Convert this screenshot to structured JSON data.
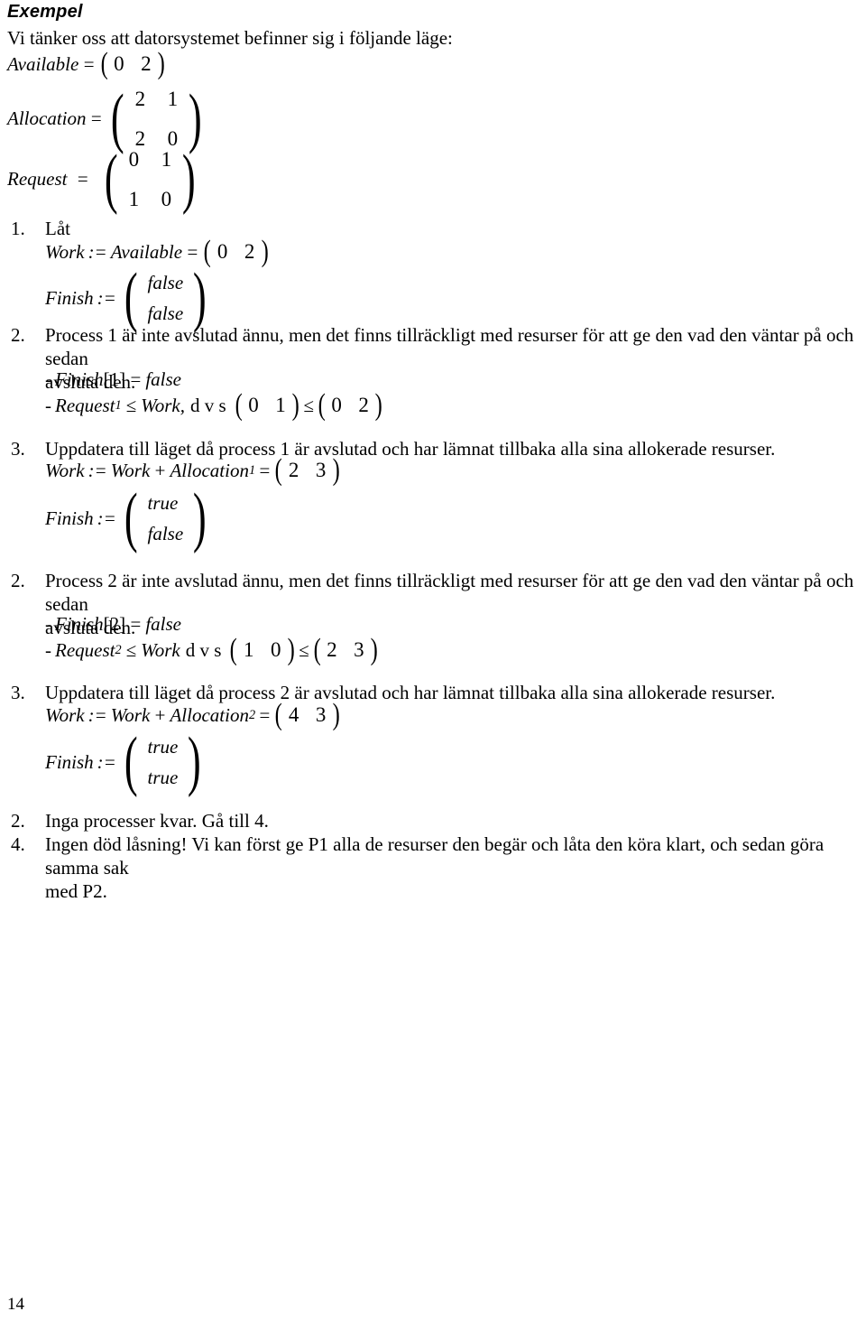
{
  "document": {
    "page_number": "14",
    "heading": "Exempel",
    "intro": "Vi tänker oss att datorsystemet befinner sig i följande läge:"
  },
  "state": {
    "available": {
      "label": "Available",
      "eq": "=",
      "values": [
        "0",
        "2"
      ]
    },
    "allocation": {
      "label": "Allocation",
      "eq": "=",
      "rows": [
        [
          "2",
          "1"
        ],
        [
          "2",
          "0"
        ]
      ]
    },
    "request": {
      "label": "Request",
      "eq": "=",
      "rows": [
        [
          "0",
          "1"
        ],
        [
          "1",
          "0"
        ]
      ]
    }
  },
  "steps": [
    {
      "num": "1.",
      "title": "Låt",
      "work_line": {
        "lhs": "Work",
        "assign": ":=",
        "rhs": "Available",
        "eq": "=",
        "values": [
          "0",
          "2"
        ]
      },
      "finish_line": {
        "label": "Finish",
        "assign": ":=",
        "values": [
          "false",
          "false"
        ]
      }
    },
    {
      "num": "2.",
      "text_line1": "Process 1 är inte avslutad ännu, men det finns tillräckligt med resurser för att ge den vad den väntar på och sedan",
      "text_line2": "avsluta den.",
      "bullet1": {
        "dash": "-",
        "name": "Finish",
        "index": "[1]",
        "eq": "=",
        "value": "false"
      },
      "bullet2": {
        "dash": "-",
        "name": "Request",
        "sub": "1",
        "rel": "≤",
        "work": "Work,",
        "note": "d v s",
        "left": [
          "0",
          "1"
        ],
        "rel2": "≤",
        "right": [
          "0",
          "2"
        ]
      }
    },
    {
      "num": "3.",
      "title": "Uppdatera till läget då process 1 är avslutad och har lämnat tillbaka alla sina allokerade resurser.",
      "work_line": {
        "lhs": "Work",
        "assign": ":=",
        "rhs": "Work",
        "plus": "+",
        "alloc": "Allocation",
        "sub": "1",
        "eq": "=",
        "values": [
          "2",
          "3"
        ]
      },
      "finish_line": {
        "label": "Finish",
        "assign": ":=",
        "values": [
          "true",
          "false"
        ]
      }
    },
    {
      "num": "2.",
      "text_line1": "Process 2 är inte avslutad ännu, men det finns tillräckligt med resurser för att ge den vad den väntar på och sedan",
      "text_line2": "avsluta den.",
      "bullet1": {
        "dash": "-",
        "name": "Finish",
        "index": "[2]",
        "eq": "=",
        "value": "false"
      },
      "bullet2": {
        "dash": "-",
        "name": "Request",
        "sub": "2",
        "rel": "≤",
        "work": "Work",
        "note": "d v s",
        "left": [
          "1",
          "0"
        ],
        "rel2": "≤",
        "right": [
          "2",
          "3"
        ]
      }
    },
    {
      "num": "3.",
      "title": "Uppdatera till läget då process 2 är avslutad och har lämnat tillbaka alla sina allokerade resurser.",
      "work_line": {
        "lhs": "Work",
        "assign": ":=",
        "rhs": "Work",
        "plus": "+",
        "alloc": "Allocation",
        "sub": "2",
        "eq": "=",
        "values": [
          "4",
          "3"
        ]
      },
      "finish_line": {
        "label": "Finish",
        "assign": ":=",
        "values": [
          "true",
          "true"
        ]
      }
    },
    {
      "num": "2.",
      "title": "Inga processer kvar. Gå till 4."
    },
    {
      "num": "4.",
      "text_line1": "Ingen död låsning! Vi kan först ge P1 alla de resurser den begär och låta den köra klart, och sedan göra samma sak",
      "text_line2": "med P2."
    }
  ],
  "symbols": {
    "paren_left": "(",
    "paren_right": ")",
    "assign": ":=",
    "equals": "=",
    "plus": "+",
    "leq": "≤"
  }
}
